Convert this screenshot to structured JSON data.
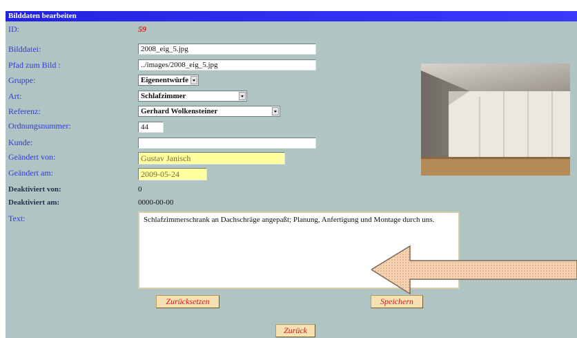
{
  "form": {
    "title": "Bilddaten bearbeiten",
    "labels": {
      "id": "ID:",
      "bilddatei": "Bilddatei:",
      "pfad": "Pfad zum Bild :",
      "gruppe": "Gruppe:",
      "art": "Art:",
      "referenz": "Referenz:",
      "ordnungsnummer": "Ordnungsnummer:",
      "kunde": "Kunde:",
      "geaendert_von": "Geändert von:",
      "geaendert_am": "Geändert am:",
      "deaktiviert_von": "Deaktiviert von:",
      "deaktiviert_am": "Deaktiviert am:",
      "text": "Text:"
    },
    "values": {
      "id": "59",
      "bilddatei": "2008_eig_5.jpg",
      "pfad": "../images/2008_eig_5.jpg",
      "gruppe": "Eigenentwürfe",
      "art": "Schlafzimmer",
      "referenz": "Gerhard Wolkensteiner",
      "ordnungsnummer": "44",
      "kunde": "",
      "geaendert_von": "Gustav Janisch",
      "geaendert_am": "2009-05-24",
      "deaktiviert_von": "0",
      "deaktiviert_am": "0000-00-00",
      "text": "Schlafzimmerschrank an Dachschräge angepaßt; Planung, Anfertigung und Montage durch uns."
    },
    "buttons": {
      "reset": "Zurücksetzen",
      "save": "Speichern",
      "back": "Zurück"
    }
  },
  "colors": {
    "background": "#b1c4c4",
    "title_bar": "#2323e0",
    "label": "#2d3bd6",
    "id_value": "#e01818",
    "readonly_field": "#ffff9e",
    "button_bg": "#f5e1b1",
    "button_text": "#d01818",
    "arrow": "#f1c7a0"
  },
  "image": {
    "content": "wardrobe under sloped ceiling"
  }
}
